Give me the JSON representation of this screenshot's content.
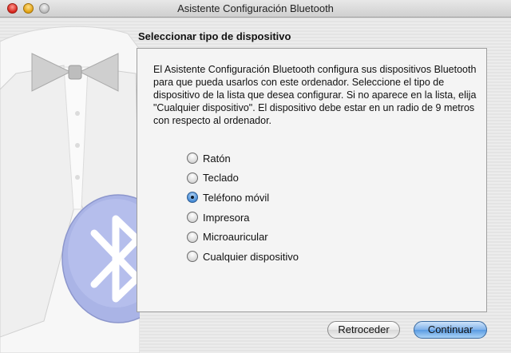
{
  "window": {
    "title": "Asistente Configuración Bluetooth"
  },
  "page": {
    "heading": "Seleccionar tipo de dispositivo",
    "description": "El Asistente Configuración Bluetooth configura sus dispositivos Bluetooth para que pueda usarlos con este ordenador. Seleccione el tipo de dispositivo de la lista que desea configurar. Si no aparece en la lista, elija \"Cualquier dispositivo\". El dispositivo debe estar en un radio de 9 metros con respecto al ordenador."
  },
  "device_types": {
    "selected": "Teléfono móvil",
    "options": [
      {
        "label": "Ratón",
        "checked": false
      },
      {
        "label": "Teclado",
        "checked": false
      },
      {
        "label": "Teléfono móvil",
        "checked": true
      },
      {
        "label": "Impresora",
        "checked": false
      },
      {
        "label": "Microauricular",
        "checked": false
      },
      {
        "label": "Cualquier dispositivo",
        "checked": false
      }
    ]
  },
  "buttons": {
    "back": "Retroceder",
    "continue": "Continuar"
  },
  "colors": {
    "primary_button": "#5a9be2",
    "bluetooth_badge": "#aab4e6"
  }
}
